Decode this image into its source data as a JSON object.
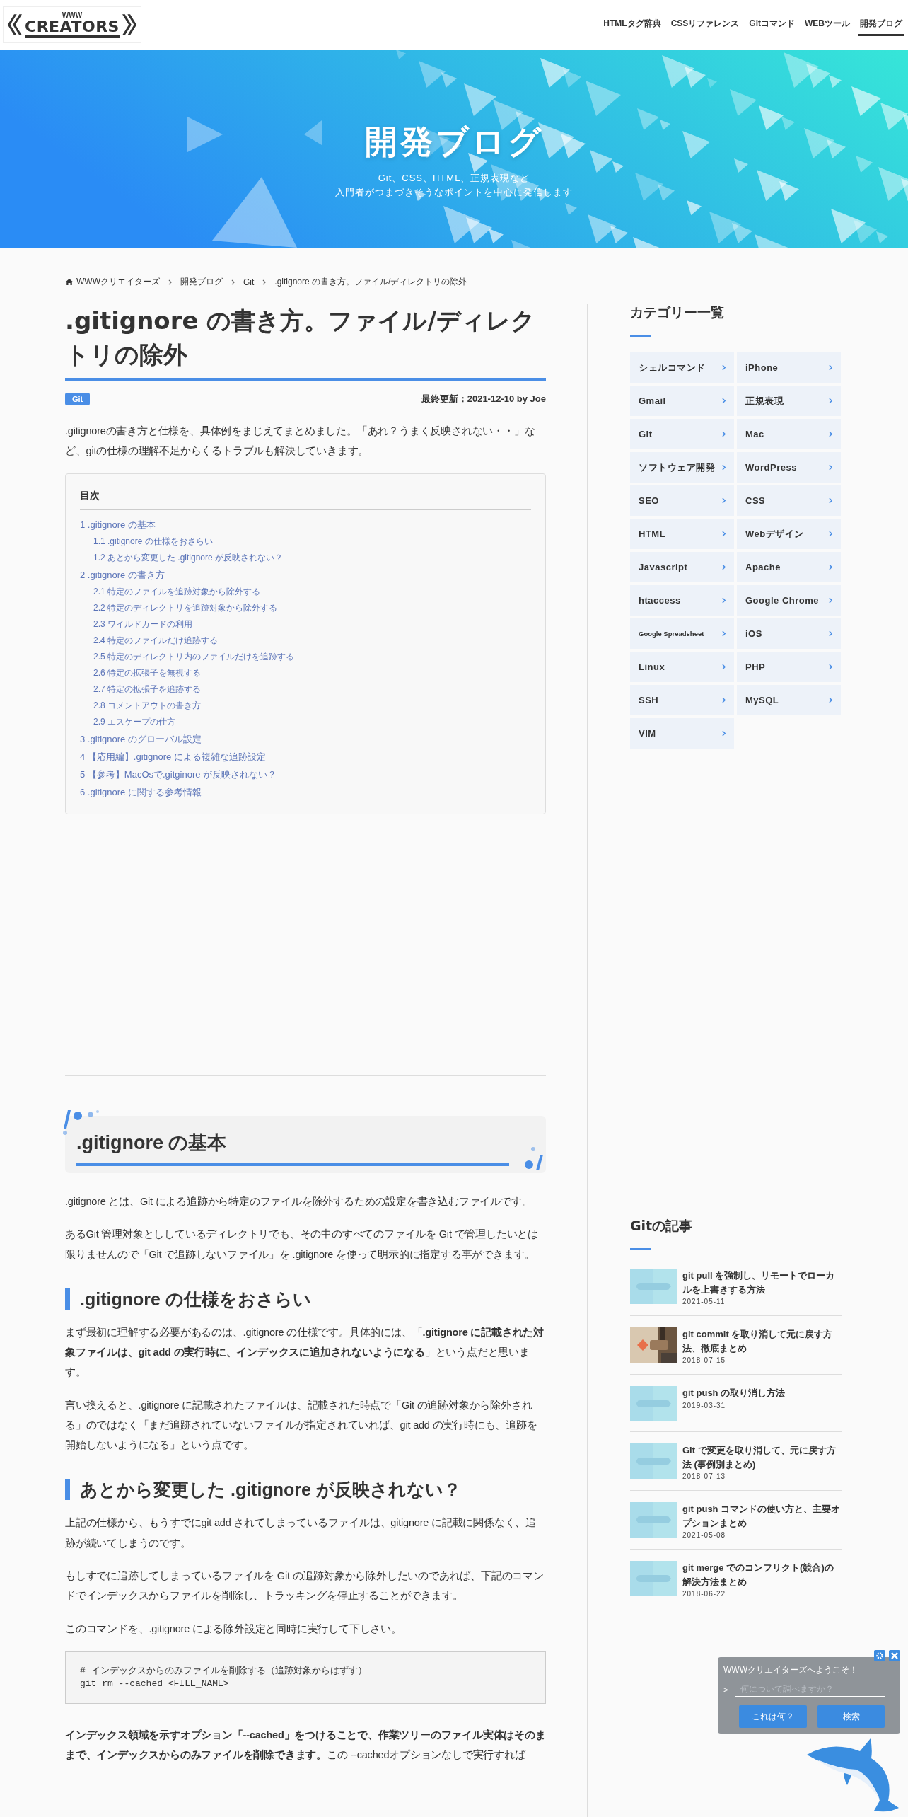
{
  "header": {
    "logo_top": "WWW",
    "logo_main": "CREATORS",
    "nav": [
      {
        "label": "HTMLタグ辞典",
        "selected": false
      },
      {
        "label": "CSSリファレンス",
        "selected": false
      },
      {
        "label": "Gitコマンド",
        "selected": false
      },
      {
        "label": "WEBツール",
        "selected": false
      },
      {
        "label": "開発ブログ",
        "selected": true
      }
    ]
  },
  "hero": {
    "title": "開発ブログ",
    "subtitle": [
      "Git、CSS、HTML、正規表現など",
      "入門者がつまづきそうなポイントを中心に発信します"
    ]
  },
  "breadcrumb": [
    "WWWクリエイターズ",
    "開発ブログ",
    "Git",
    ".gitignore の書き方。ファイル/ディレクトリの除外"
  ],
  "article": {
    "title": ".gitignore の書き方。ファイル/ディレクトリの除外",
    "tag": "Git",
    "meta": "最終更新：2021-12-10 by Joe",
    "intro": ".gitignoreの書き方と仕様を、具体例をまじえてまとめました。「あれ？うまく反映されない・・」など、gitの仕様の理解不足からくるトラブルも解決していきます。",
    "toc": {
      "title": "目次",
      "items": [
        {
          "label": "1 .gitignore の基本",
          "children": [
            {
              "label": "1.1 .gitignore の仕様をおさらい"
            },
            {
              "label": "1.2 あとから変更した .gitignore が反映されない？"
            }
          ]
        },
        {
          "label": "2 .gitignore の書き方",
          "children": [
            {
              "label": "2.1 特定のファイルを追跡対象から除外する"
            },
            {
              "label": "2.2 特定のディレクトリを追跡対象から除外する"
            },
            {
              "label": "2.3 ワイルドカードの利用"
            },
            {
              "label": "2.4 特定のファイルだけ追跡する"
            },
            {
              "label": "2.5 特定のディレクトリ内のファイルだけを追跡する"
            },
            {
              "label": "2.6 特定の拡張子を無視する"
            },
            {
              "label": "2.7 特定の拡張子を追跡する"
            },
            {
              "label": "2.8 コメントアウトの書き方"
            },
            {
              "label": "2.9 エスケープの仕方"
            }
          ]
        },
        {
          "label": "3 .gitignore のグローバル設定"
        },
        {
          "label": "4 【応用編】.gitignore による複雑な追跡設定"
        },
        {
          "label": "5 【参考】MacOsで.gitginore が反映されない？"
        },
        {
          "label": "6 .gitignore に関する参考情報"
        }
      ]
    },
    "body": [
      {
        "kind": "h2",
        "text": ".gitignore の基本"
      },
      {
        "kind": "p",
        "text": ".gitignore とは、Git による追跡から特定のファイルを除外するための設定を書き込むファイルです。"
      },
      {
        "kind": "p",
        "text": "あるGit 管理対象とししているディレクトリでも、その中のすべてのファイルを Git で管理したいとは限りませんので「Git で追跡しないファイル」を .gitignore を使って明示的に指定する事ができます。"
      },
      {
        "kind": "h3",
        "text": ".gitignore の仕様をおさらい"
      },
      {
        "kind": "p",
        "text": "まず最初に理解する必要があるのは、.gitignore の仕様です。具体的には、「**.gitignore に記載された対象ファイルは、git add の実行時に、インデックスに追加されないようになる**」という点だと思います。"
      },
      {
        "kind": "p",
        "text": "言い換えると、.gitignore に記載されたファイルは、記載された時点で「Git の追跡対象から除外される」のではなく「まだ追跡されていないファイルが指定されていれば、git add の実行時にも、追跡を開始しないようになる」という点です。"
      },
      {
        "kind": "h3",
        "text": "あとから変更した .gitignore が反映されない？"
      },
      {
        "kind": "p",
        "text": "上記の仕様から、もうすでにgit add されてしまっているファイルは、gitignore に記載に関係なく、追跡が続いてしまうのです。"
      },
      {
        "kind": "p",
        "text": "もしすでに追跡してしまっているファイルを Git の追跡対象から除外したいのであれば、下記のコマンドでインデックスからファイルを削除し、トラッキングを停止することができます。"
      },
      {
        "kind": "p",
        "text": "このコマンドを、.gitignore による除外設定と同時に実行して下しさい。"
      },
      {
        "kind": "code",
        "lines": [
          "# インデックスからのみファイルを削除する（追跡対象からはずす）",
          "git rm --cached <FILE_NAME>"
        ]
      },
      {
        "kind": "p",
        "text": "**インデックス領域を示すオプション「--cached」をつけることで、作業ツリーのファイル実体はそのままで、インデックスからのみファイルを削除できます。**この --cachedオプションなしで実行すれば"
      }
    ]
  },
  "sidebar": {
    "categories_title": "カテゴリー一覧",
    "categories": [
      "シェルコマンド",
      "iPhone",
      "Gmail",
      "正規表現",
      "Git",
      "Mac",
      "ソフトウェア開発",
      "WordPress",
      "SEO",
      "CSS",
      "HTML",
      "Webデザイン",
      "Javascript",
      "Apache",
      "htaccess",
      "Google Chrome",
      "Google Spreadsheet",
      "iOS",
      "Linux",
      "PHP",
      "SSH",
      "MySQL",
      "VIM"
    ],
    "posts_title": "Gitの記事",
    "posts": [
      {
        "title": "git pull を強制し、リモートでローカルを上書きする方法",
        "date": "2021-05-11",
        "kind": "placeholder"
      },
      {
        "title": "git commit を取り消して元に戻す方法、徹底まとめ",
        "date": "2018-07-15"
      },
      {
        "title": "git push の取り消し方法",
        "date": "2019-03-31",
        "kind": "placeholder"
      },
      {
        "title": "Git で変更を取り消して、元に戻す方法 (事例別まとめ)",
        "date": "2018-07-13",
        "kind": "placeholder"
      },
      {
        "title": "git push コマンドの使い方と、主要オプションまとめ",
        "date": "2021-05-08",
        "kind": "placeholder"
      },
      {
        "title": "git merge でのコンフリクト(競合)の解決方法まとめ",
        "date": "2018-06-22",
        "kind": "placeholder"
      }
    ]
  },
  "assistant": {
    "greeting": "WWWクリエイターズへようこそ！",
    "prompt": ">",
    "placeholder": "何について調べますか？",
    "buttons": [
      "これは何？",
      "検索"
    ]
  }
}
